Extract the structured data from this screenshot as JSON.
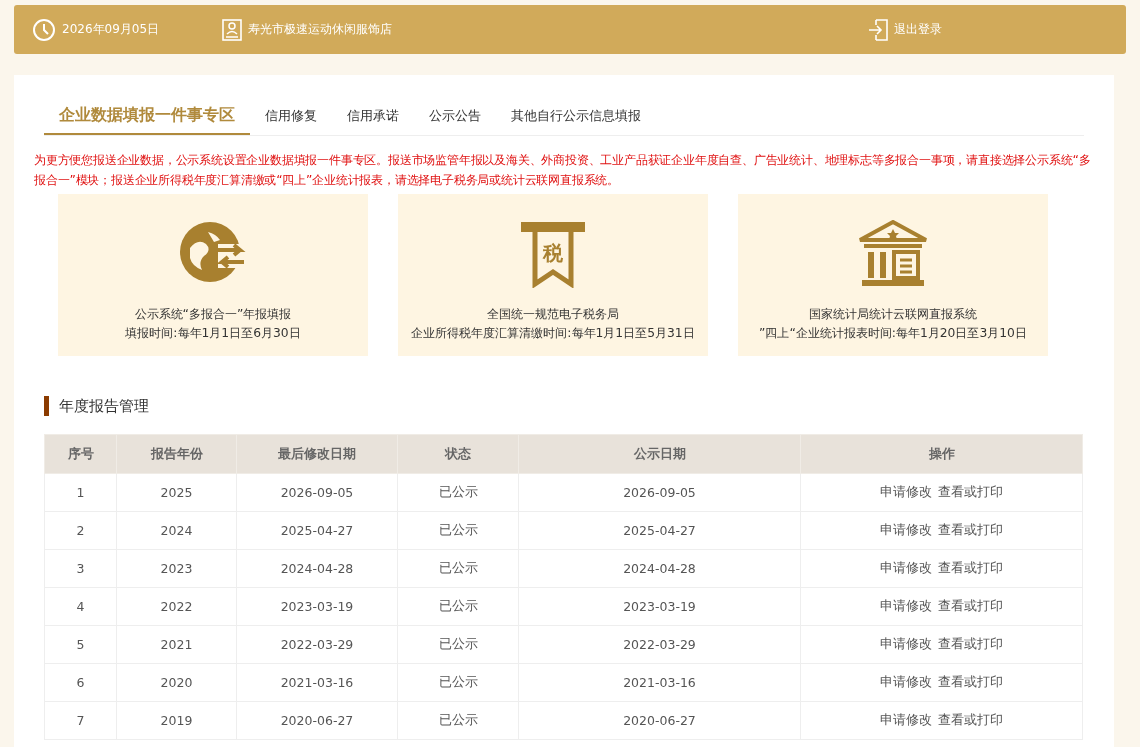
{
  "header": {
    "date": "2026年09月05日",
    "shop": "寿光市极速运动休闲服饰店",
    "logout": "退出登录"
  },
  "tabs": [
    {
      "label": "企业数据填报一件事专区",
      "selected": true
    },
    {
      "label": "信用修复",
      "selected": false
    },
    {
      "label": "信用承诺",
      "selected": false
    },
    {
      "label": "公示公告",
      "selected": false
    },
    {
      "label": "其他自行公示信息填报",
      "selected": false
    }
  ],
  "notice": "为更方便您报送企业数据，公示系统设置企业数据填报一件事专区。报送市场监管年报以及海关、外商投资、工业产品获证企业年度自查、广告业统计、地理标志等多报合一事项，请直接选择公示系统“多报合一”模块；报送企业所得税年度汇算清缴或“四上”企业统计报表，请选择电子税务局或统计云联网直报系统。",
  "cards": [
    {
      "kind": "map",
      "title": "公示系统“多报合一”年报填报",
      "subtitle": "填报时间:每年1月1日至6月30日"
    },
    {
      "kind": "tax",
      "icon_text": "税",
      "title": "全国统一规范电子税务局",
      "subtitle": "企业所得税年度汇算清缴时间:每年1月1日至5月31日"
    },
    {
      "kind": "bank",
      "title": "国家统计局统计云联网直报系统",
      "subtitle": "”四上“企业统计报表时间:每年1月20日至3月10日"
    }
  ],
  "section_title": "年度报告管理",
  "table": {
    "columns": [
      "序号",
      "报告年份",
      "最后修改日期",
      "状态",
      "公示日期",
      "操作"
    ],
    "rows": [
      {
        "cells": [
          "1",
          "2025",
          "2026-09-05",
          "已公示",
          "2026-09-05"
        ],
        "actions": [
          "申请修改",
          "查看或打印"
        ]
      },
      {
        "cells": [
          "2",
          "2024",
          "2025-04-27",
          "已公示",
          "2025-04-27"
        ],
        "actions": [
          "申请修改",
          "查看或打印"
        ]
      },
      {
        "cells": [
          "3",
          "2023",
          "2024-04-28",
          "已公示",
          "2024-04-28"
        ],
        "actions": [
          "申请修改",
          "查看或打印"
        ]
      },
      {
        "cells": [
          "4",
          "2022",
          "2023-03-19",
          "已公示",
          "2023-03-19"
        ],
        "actions": [
          "申请修改",
          "查看或打印"
        ]
      },
      {
        "cells": [
          "5",
          "2021",
          "2022-03-29",
          "已公示",
          "2022-03-29"
        ],
        "actions": [
          "申请修改",
          "查看或打印"
        ]
      },
      {
        "cells": [
          "6",
          "2020",
          "2021-03-16",
          "已公示",
          "2021-03-16"
        ],
        "actions": [
          "申请修改",
          "查看或打印"
        ]
      },
      {
        "cells": [
          "7",
          "2019",
          "2020-06-27",
          "已公示",
          "2020-06-27"
        ],
        "actions": [
          "申请修改",
          "查看或打印"
        ]
      }
    ]
  }
}
